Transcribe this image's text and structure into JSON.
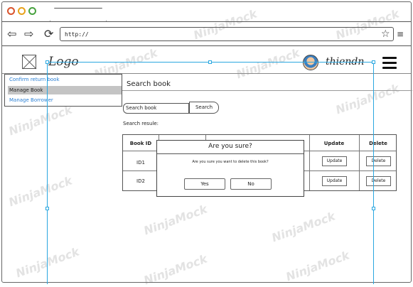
{
  "browser": {
    "window_buttons": [
      "#d9532c",
      "#e8a21b",
      "#48a23f"
    ],
    "url": "http://"
  },
  "header": {
    "logo": "Logo",
    "username": "thiendn"
  },
  "sidebar": {
    "items": [
      {
        "label": "Confirm return book",
        "color": "#2a7fd4"
      },
      {
        "label": "Manage Book",
        "color": "#222222",
        "active": true
      },
      {
        "label": "Manage Borrower",
        "color": "#2a7fd4"
      }
    ]
  },
  "main": {
    "title": "Search book",
    "search_placeholder": "Search book",
    "search_button": "Search",
    "result_label": "Search resule:"
  },
  "table": {
    "headers": [
      "Book ID",
      "Update",
      "Delete"
    ],
    "rows": [
      {
        "id": "ID1",
        "update": "Update",
        "delete": "Delete"
      },
      {
        "id": "ID2",
        "update": "Update",
        "delete": "Delete"
      }
    ]
  },
  "dialog": {
    "title": "Are you sure?",
    "message": "Are you sure you want to delete this book?",
    "yes": "Yes",
    "no": "No"
  },
  "watermark": "NinjaMock",
  "accent_color": "#2aa7e0"
}
